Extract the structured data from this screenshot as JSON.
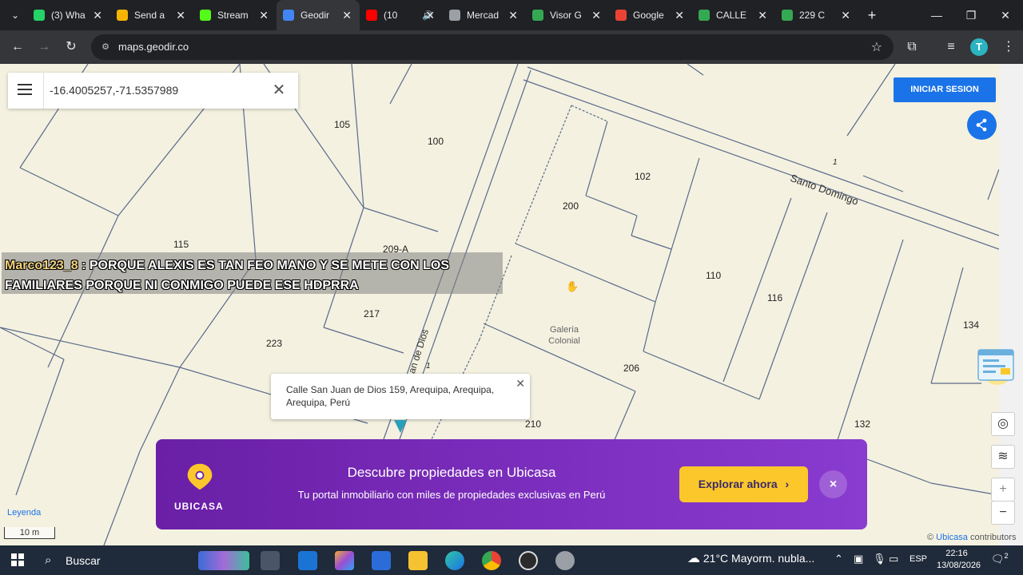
{
  "browser": {
    "tabs": [
      {
        "title": "(3) Wha",
        "icon": "whatsapp-icon",
        "color": "#25d366",
        "sound": ""
      },
      {
        "title": "Send a",
        "icon": "send-icon",
        "color": "#f4b400",
        "sound": ""
      },
      {
        "title": "Stream",
        "icon": "kick-icon",
        "color": "#53fc18",
        "sound": ""
      },
      {
        "title": "Geodir",
        "icon": "map-pin-icon",
        "color": "#4285f4",
        "sound": "",
        "active": true
      },
      {
        "title": "(10",
        "icon": "youtube-icon",
        "color": "#ff0000",
        "sound": "🔊"
      },
      {
        "title": "Mercad",
        "icon": "map-pin-icon",
        "color": "#9aa0a6",
        "sound": ""
      },
      {
        "title": "Visor G",
        "icon": "map-pin-icon",
        "color": "#34a853",
        "sound": ""
      },
      {
        "title": "Google",
        "icon": "map-pin-icon",
        "color": "#ea4335",
        "sound": ""
      },
      {
        "title": "CALLE",
        "icon": "map-pin-icon",
        "color": "#34a853",
        "sound": ""
      },
      {
        "title": "229 C",
        "icon": "map-pin-icon",
        "color": "#34a853",
        "sound": ""
      }
    ],
    "url": "maps.geodir.co",
    "profile_initial": "T"
  },
  "map": {
    "search_value": "-16.4005257,-71.5357989",
    "login_label": "INICIAR SESION",
    "lot_numbers": [
      "105",
      "100",
      "102",
      "200",
      "115",
      "209-A",
      "110",
      "116",
      "134",
      "217",
      "223",
      "206",
      "132",
      "210"
    ],
    "galeria_label": "Galería Colonial",
    "street_santo_domingo": "Santo Domingo",
    "street_san_juan": "an de Dios",
    "house_one": "1",
    "popup_address": "Calle San Juan de Dios 159, Arequipa, Arequipa, Arequipa, Perú",
    "legend_label": "Leyenda",
    "scale_label": "10 m",
    "attribution_prefix": "©",
    "attribution_link": "Ubicasa",
    "attribution_suffix": "contributors"
  },
  "chat": {
    "user": "Marco123_8",
    "message_line1": ": PORQUE ALEXIS ES TAN FEO MANO Y SE METE CON LOS",
    "message_line2": "FAMILIARES PORQUE NI CONMIGO PUEDE ESE HDPRRA"
  },
  "banner": {
    "brand": "UBICASA",
    "title": "Descubre propiedades en Ubicasa",
    "subtitle": "Tu portal inmobiliario con miles de propiedades exclusivas en Perú",
    "cta_label": "Explorar ahora",
    "cta_arrow": "›",
    "close": "×"
  },
  "taskbar": {
    "search_placeholder": "Buscar",
    "weather": "21°C  Mayorm. nubla...",
    "language": "ESP",
    "time": "22:16",
    "date": "13/08/2026",
    "notifications": "2"
  },
  "colors": {
    "accent": "#1a73e8",
    "banner": "#7b2fbe",
    "cta": "#fbc72b",
    "map_bg": "#f4f1e0"
  }
}
